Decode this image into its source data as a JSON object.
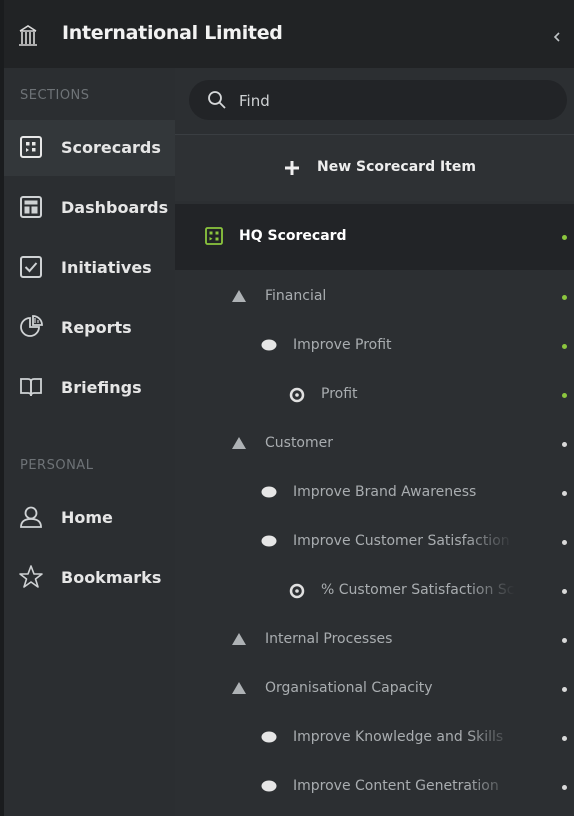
{
  "header": {
    "org_name": "International Limited"
  },
  "sidebar": {
    "sections_label": "SECTIONS",
    "personal_label": "PERSONAL",
    "items": [
      {
        "label": "Scorecards",
        "icon": "scorecard-icon",
        "active": true
      },
      {
        "label": "Dashboards",
        "icon": "dashboard-icon"
      },
      {
        "label": "Initiatives",
        "icon": "checkbox-icon"
      },
      {
        "label": "Reports",
        "icon": "pie-chart-icon"
      },
      {
        "label": "Briefings",
        "icon": "book-icon"
      }
    ],
    "personal_items": [
      {
        "label": "Home",
        "icon": "user-icon"
      },
      {
        "label": "Bookmarks",
        "icon": "star-icon"
      }
    ]
  },
  "search": {
    "placeholder": "Find"
  },
  "new_item": {
    "label": "New Scorecard Item"
  },
  "scorecard": {
    "label": "HQ Scorecard",
    "status_color": "#8cc63e"
  },
  "tree": [
    {
      "label": "Financial",
      "type": "perspective",
      "status": "green"
    },
    {
      "label": "Improve Profit",
      "type": "objective",
      "status": "green"
    },
    {
      "label": "Profit",
      "type": "measure",
      "status": "green"
    },
    {
      "label": "Customer",
      "type": "perspective",
      "status": "grey"
    },
    {
      "label": "Improve Brand Awareness",
      "type": "objective",
      "status": "grey"
    },
    {
      "label": "Improve Customer Satisfaction",
      "type": "objective",
      "status": "grey"
    },
    {
      "label": "% Customer Satisfaction Score",
      "type": "measure",
      "status": "grey"
    },
    {
      "label": "Internal Processes",
      "type": "perspective",
      "status": "grey"
    },
    {
      "label": "Organisational Capacity",
      "type": "perspective",
      "status": "grey"
    },
    {
      "label": "Improve Knowledge and Skills",
      "type": "objective",
      "status": "grey"
    },
    {
      "label": "Improve Content Genetration",
      "type": "objective",
      "status": "grey"
    }
  ],
  "colors": {
    "status_green": "#8cc63e",
    "status_grey": "#d9d9d9",
    "accent_active": "#8fc1e8"
  }
}
